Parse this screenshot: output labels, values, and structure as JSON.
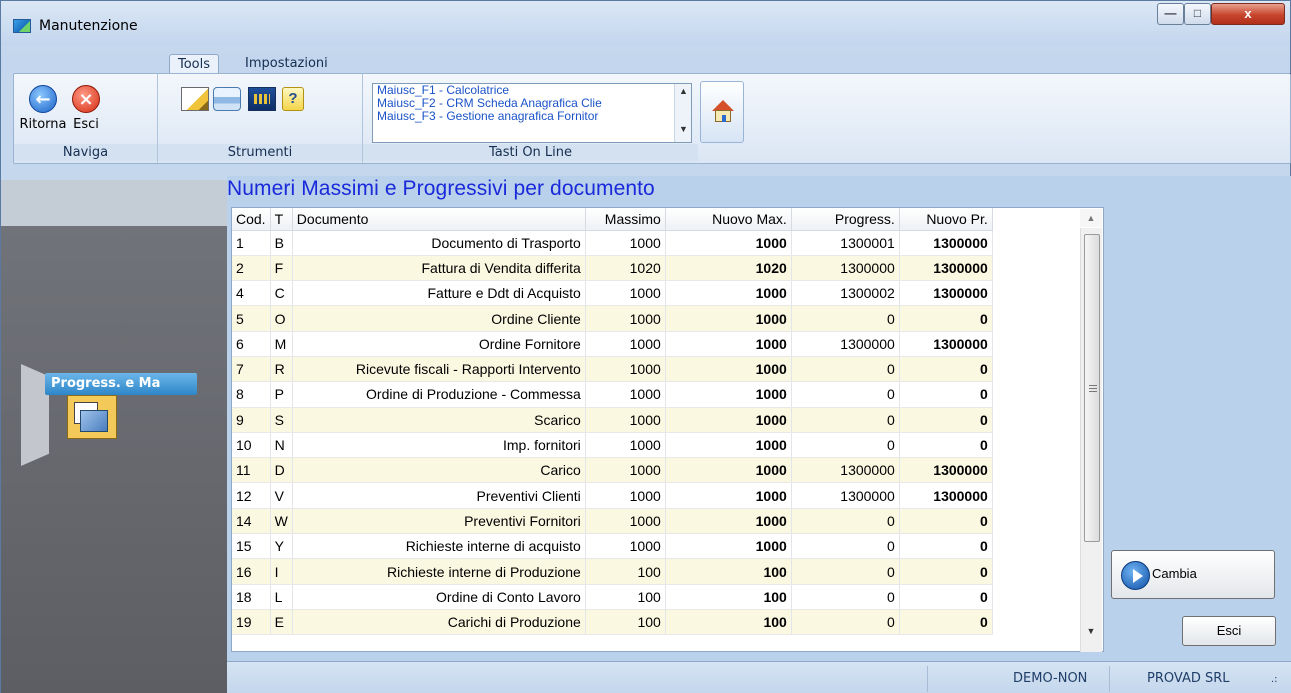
{
  "window": {
    "title": "Manutenzione",
    "controls": {
      "minimize": "—",
      "maximize": "□",
      "close": "x"
    }
  },
  "ribbon": {
    "tabs": [
      {
        "label": "Tools",
        "active": true
      },
      {
        "label": "Impostazioni",
        "active": false
      }
    ],
    "groups": {
      "naviga": {
        "label": "Naviga",
        "buttons": [
          {
            "label": "Ritorna",
            "icon": "arrow-left-icon"
          },
          {
            "label": "Esci",
            "icon": "close-icon"
          }
        ]
      },
      "strumenti": {
        "label": "Strumenti",
        "tools": [
          "edit-icon",
          "print-icon",
          "calculator-icon",
          "help-icon"
        ]
      },
      "tasti_online": {
        "label": "Tasti On Line",
        "items": [
          "Maiusc_F1  - Calcolatrice",
          "Maiusc_F2  - CRM Scheda Anagrafica Clie",
          "Maiusc_F3  - Gestione anagrafica Fornitor"
        ]
      },
      "home": {
        "icon": "home-icon"
      }
    }
  },
  "left_panel": {
    "nav_label": "Progress. e Ma",
    "nav_icon": "documents-icon"
  },
  "main": {
    "heading": "Numeri Massimi e Progressivi per documento",
    "columns": [
      "Cod.",
      "T",
      "Documento",
      "Massimo",
      "Nuovo Max.",
      "Progress.",
      "Nuovo Pr."
    ],
    "rows": [
      {
        "cod": "1",
        "t": "B",
        "documento": "Documento di Trasporto",
        "massimo": "1000",
        "nuovo_max": "1000",
        "progress": "1300001",
        "nuovo_pr": "1300000"
      },
      {
        "cod": "2",
        "t": "F",
        "documento": "Fattura di Vendita differita",
        "massimo": "1020",
        "nuovo_max": "1020",
        "progress": "1300000",
        "nuovo_pr": "1300000"
      },
      {
        "cod": "4",
        "t": "C",
        "documento": "Fatture e Ddt di Acquisto",
        "massimo": "1000",
        "nuovo_max": "1000",
        "progress": "1300002",
        "nuovo_pr": "1300000"
      },
      {
        "cod": "5",
        "t": "O",
        "documento": "Ordine Cliente",
        "massimo": "1000",
        "nuovo_max": "1000",
        "progress": "0",
        "nuovo_pr": "0"
      },
      {
        "cod": "6",
        "t": "M",
        "documento": "Ordine Fornitore",
        "massimo": "1000",
        "nuovo_max": "1000",
        "progress": "1300000",
        "nuovo_pr": "1300000"
      },
      {
        "cod": "7",
        "t": "R",
        "documento": "Ricevute fiscali - Rapporti Intervento",
        "massimo": "1000",
        "nuovo_max": "1000",
        "progress": "0",
        "nuovo_pr": "0"
      },
      {
        "cod": "8",
        "t": "P",
        "documento": "Ordine di Produzione - Commessa",
        "massimo": "1000",
        "nuovo_max": "1000",
        "progress": "0",
        "nuovo_pr": "0"
      },
      {
        "cod": "9",
        "t": "S",
        "documento": "Scarico",
        "massimo": "1000",
        "nuovo_max": "1000",
        "progress": "0",
        "nuovo_pr": "0"
      },
      {
        "cod": "10",
        "t": "N",
        "documento": "Imp. fornitori",
        "massimo": "1000",
        "nuovo_max": "1000",
        "progress": "0",
        "nuovo_pr": "0"
      },
      {
        "cod": "11",
        "t": "D",
        "documento": "Carico",
        "massimo": "1000",
        "nuovo_max": "1000",
        "progress": "1300000",
        "nuovo_pr": "1300000"
      },
      {
        "cod": "12",
        "t": "V",
        "documento": "Preventivi Clienti",
        "massimo": "1000",
        "nuovo_max": "1000",
        "progress": "1300000",
        "nuovo_pr": "1300000"
      },
      {
        "cod": "14",
        "t": "W",
        "documento": "Preventivi Fornitori",
        "massimo": "1000",
        "nuovo_max": "1000",
        "progress": "0",
        "nuovo_pr": "0"
      },
      {
        "cod": "15",
        "t": "Y",
        "documento": "Richieste interne di acquisto",
        "massimo": "1000",
        "nuovo_max": "1000",
        "progress": "0",
        "nuovo_pr": "0"
      },
      {
        "cod": "16",
        "t": "I",
        "documento": "Richieste interne di Produzione",
        "massimo": "100",
        "nuovo_max": "100",
        "progress": "0",
        "nuovo_pr": "0"
      },
      {
        "cod": "18",
        "t": "L",
        "documento": "Ordine di Conto Lavoro",
        "massimo": "100",
        "nuovo_max": "100",
        "progress": "0",
        "nuovo_pr": "0"
      },
      {
        "cod": "19",
        "t": "E",
        "documento": "Carichi di Produzione",
        "massimo": "100",
        "nuovo_max": "100",
        "progress": "0",
        "nuovo_pr": "0"
      }
    ],
    "buttons": {
      "cambia": "Cambia",
      "esci": "Esci"
    }
  },
  "status": {
    "cell1": "DEMO-NON",
    "cell2": "PROVAD SRL"
  }
}
